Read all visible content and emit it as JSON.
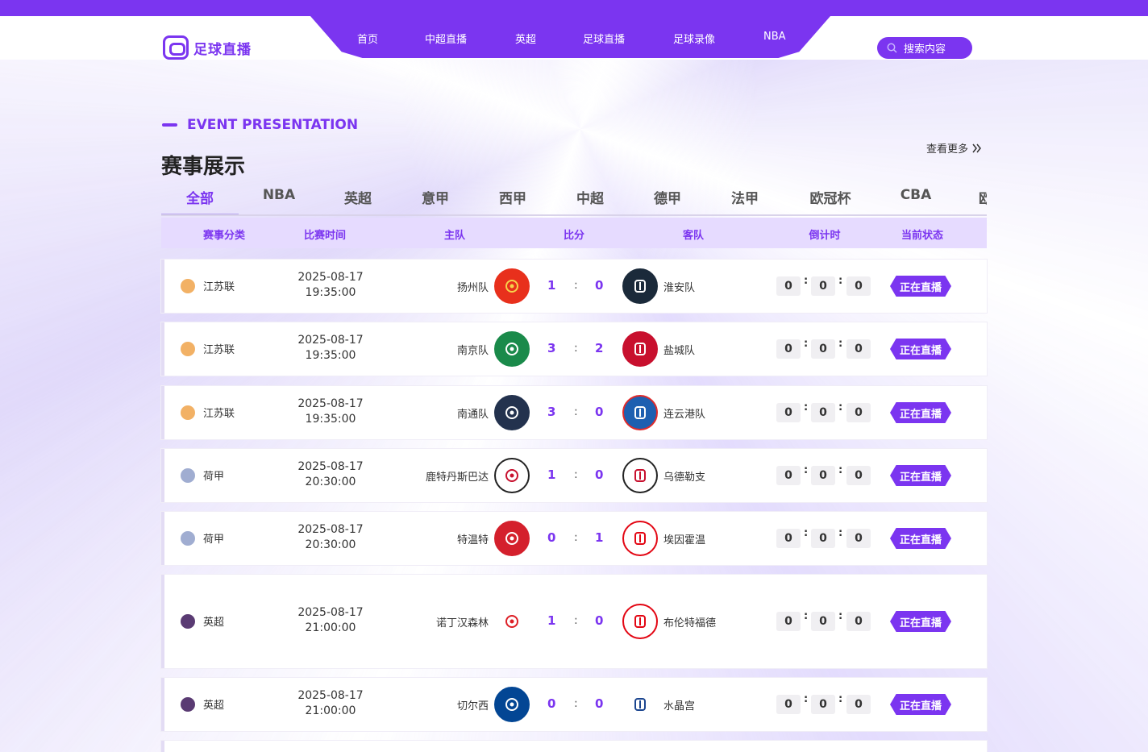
{
  "header": {
    "logo_text": "足球直播",
    "nav": [
      "首页",
      "中超直播",
      "英超",
      "足球直播",
      "足球录像",
      "NBA"
    ],
    "search_label": "搜索内容"
  },
  "section": {
    "title_en": "EVENT PRESENTATION",
    "title_cn": "赛事展示",
    "more_label": "查看更多"
  },
  "tabs": [
    "全部",
    "NBA",
    "英超",
    "意甲",
    "西甲",
    "中超",
    "德甲",
    "法甲",
    "欧冠杯",
    "CBA",
    "欧"
  ],
  "active_tab": "全部",
  "table": {
    "headers": [
      "赛事分类",
      "比赛时间",
      "主队",
      "比分",
      "客队",
      "倒计时",
      "当前状态"
    ],
    "rows": [
      {
        "league": "江苏联",
        "date": "2025-08-17",
        "time": "19:35:00",
        "home": "扬州队",
        "home_score": "1",
        "sep": ":",
        "away_score": "0",
        "away": "淮安队",
        "cd": [
          "0",
          "0",
          "0"
        ],
        "status": "正在直播"
      },
      {
        "league": "江苏联",
        "date": "2025-08-17",
        "time": "19:35:00",
        "home": "南京队",
        "home_score": "3",
        "sep": ":",
        "away_score": "2",
        "away": "盐城队",
        "cd": [
          "0",
          "0",
          "0"
        ],
        "status": "正在直播"
      },
      {
        "league": "江苏联",
        "date": "2025-08-17",
        "time": "19:35:00",
        "home": "南通队",
        "home_score": "3",
        "sep": ":",
        "away_score": "0",
        "away": "连云港队",
        "cd": [
          "0",
          "0",
          "0"
        ],
        "status": "正在直播"
      },
      {
        "league": "荷甲",
        "date": "2025-08-17",
        "time": "20:30:00",
        "home": "鹿特丹斯巴达",
        "home_score": "1",
        "sep": ":",
        "away_score": "0",
        "away": "乌德勒支",
        "cd": [
          "0",
          "0",
          "0"
        ],
        "status": "正在直播"
      },
      {
        "league": "荷甲",
        "date": "2025-08-17",
        "time": "20:30:00",
        "home": "特温特",
        "home_score": "0",
        "sep": ":",
        "away_score": "1",
        "away": "埃因霍温",
        "cd": [
          "0",
          "0",
          "0"
        ],
        "status": "正在直播"
      },
      {
        "league": "英超",
        "date": "2025-08-17",
        "time": "21:00:00",
        "home": "诺丁汉森林",
        "home_score": "1",
        "sep": ":",
        "away_score": "0",
        "away": "布伦特福德",
        "cd": [
          "0",
          "0",
          "0"
        ],
        "status": "正在直播"
      },
      {
        "league": "英超",
        "date": "2025-08-17",
        "time": "21:00:00",
        "home": "切尔西",
        "home_score": "0",
        "sep": ":",
        "away_score": "0",
        "away": "水晶宫",
        "cd": [
          "0",
          "0",
          "0"
        ],
        "status": "正在直播"
      }
    ]
  },
  "colors": {
    "accent": "#7b35f0",
    "header_bg": "#e6dbff"
  }
}
